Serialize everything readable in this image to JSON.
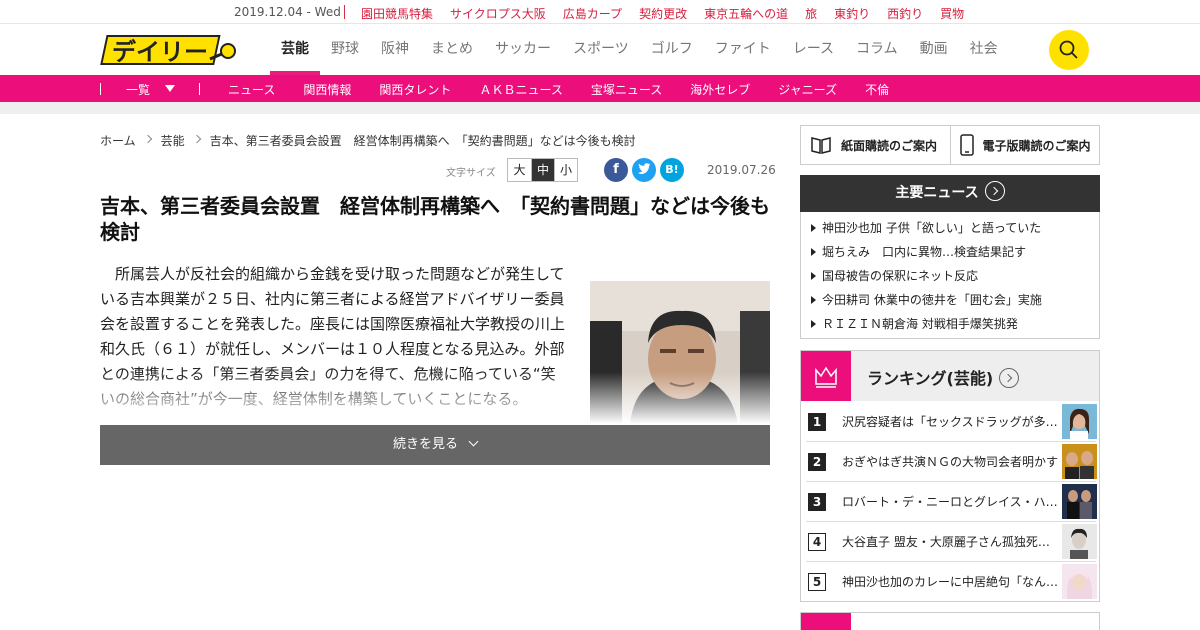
{
  "topbar": {
    "date": "2019.12.04 - Wed",
    "links": [
      "園田競馬特集",
      "サイクロプス大阪",
      "広島カープ",
      "契約更改",
      "東京五輪への道",
      "旅",
      "東釣り",
      "西釣り",
      "買物"
    ]
  },
  "header": {
    "logo_text": "デイリー",
    "nav": [
      "芸能",
      "野球",
      "阪神",
      "まとめ",
      "サッカー",
      "スポーツ",
      "ゴルフ",
      "ファイト",
      "レース",
      "コラム",
      "動画",
      "社会"
    ],
    "active_nav": "芸能",
    "search_icon": "search-icon"
  },
  "subnav": {
    "all_label": "一覧",
    "items": [
      "ニュース",
      "関西情報",
      "関西タレント",
      "ＡＫＢニュース",
      "宝塚ニュース",
      "海外セレブ",
      "ジャニーズ",
      "不倫"
    ]
  },
  "breadcrumb": [
    "ホーム",
    "芸能",
    "吉本、第三者委員会設置　経営体制再構築へ　「契約書問題」などは今後も検討"
  ],
  "tools": {
    "fontsize_label": "文字サイズ",
    "sizes": [
      "大",
      "中",
      "小"
    ],
    "selected_size": "中",
    "share": [
      {
        "name": "facebook",
        "glyph": "f",
        "color": "#3b5998"
      },
      {
        "name": "twitter",
        "glyph": "t",
        "color": "#1da1f2"
      },
      {
        "name": "hatena",
        "glyph": "B!",
        "color": "#00a4de"
      }
    ],
    "date": "2019.07.26"
  },
  "article": {
    "headline": "吉本、第三者委員会設置　経営体制再構築へ　「契約書問題」などは今後も検討",
    "body": "所属芸人が反社会的組織から金銭を受け取った問題などが発生している吉本興業が２５日、社内に第三者による経営アドバイザリー委員会を設置することを発表した。座長には国際医療福祉大学教授の川上和久氏（６１）が就任し、メンバーは１０人程度となる見込み。外部との連携による「第三者委員会」の力を得て、危機に陥っている“笑いの総合商社”が今一度、経営体制を構築していくことになる。",
    "more_label": "続きを見る"
  },
  "sidebar": {
    "subscribe_paper": "紙面購読のご案内",
    "subscribe_digital": "電子版購読のご案内",
    "major_news_title": "主要ニュース",
    "major_news": [
      "神田沙也加 子供「欲しい」と語っていた",
      "堀ちえみ　口内に異物…検査結果記す",
      "国母被告の保釈にネット反応",
      "今田耕司 休業中の徳井を「囲む会」実施",
      "ＲＩＺＩＮ朝倉海 対戦相手爆笑挑発"
    ],
    "ranking_title": "ランキング(芸能)",
    "ranking": [
      {
        "rank": "1",
        "text": "沢尻容疑者は「セックスドラッグが多…"
      },
      {
        "rank": "2",
        "text": "おぎやはぎ共演ＮＧの大物司会者明かす"
      },
      {
        "rank": "3",
        "text": "ロバート・デ・ニーロとグレイス・ハ…"
      },
      {
        "rank": "4",
        "text": "大谷直子 盟友・大原麗子さん孤独死…"
      },
      {
        "rank": "5",
        "text": "神田沙也加のカレーに中居絶句「なん…"
      }
    ]
  },
  "colors": {
    "accent": "#ec0e7b",
    "topbar_link": "#d6203f",
    "logo_yellow": "#ffe100"
  }
}
